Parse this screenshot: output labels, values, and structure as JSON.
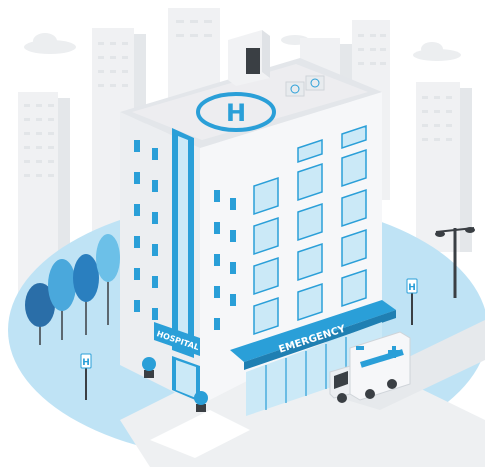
{
  "illustration": {
    "signs": {
      "hospital": "HOSPITAL",
      "emergency": "EMERGENCY",
      "helipad": "H",
      "street_sign_left": "H",
      "street_sign_right": "H"
    },
    "colors": {
      "accent_blue": "#2a9fd8",
      "light_blue": "#cbe9f7",
      "ground_blue": "#bfe3f5",
      "building_white": "#f4f6f8",
      "building_shadow": "#dde2e7",
      "background_buildings": "#eef0f2",
      "dark_gray": "#3a3f44"
    },
    "icons": [
      "helipad-icon",
      "ambulance-icon",
      "tree-icon",
      "street-lamp-icon",
      "cloud-icon",
      "potted-plant-icon"
    ]
  }
}
